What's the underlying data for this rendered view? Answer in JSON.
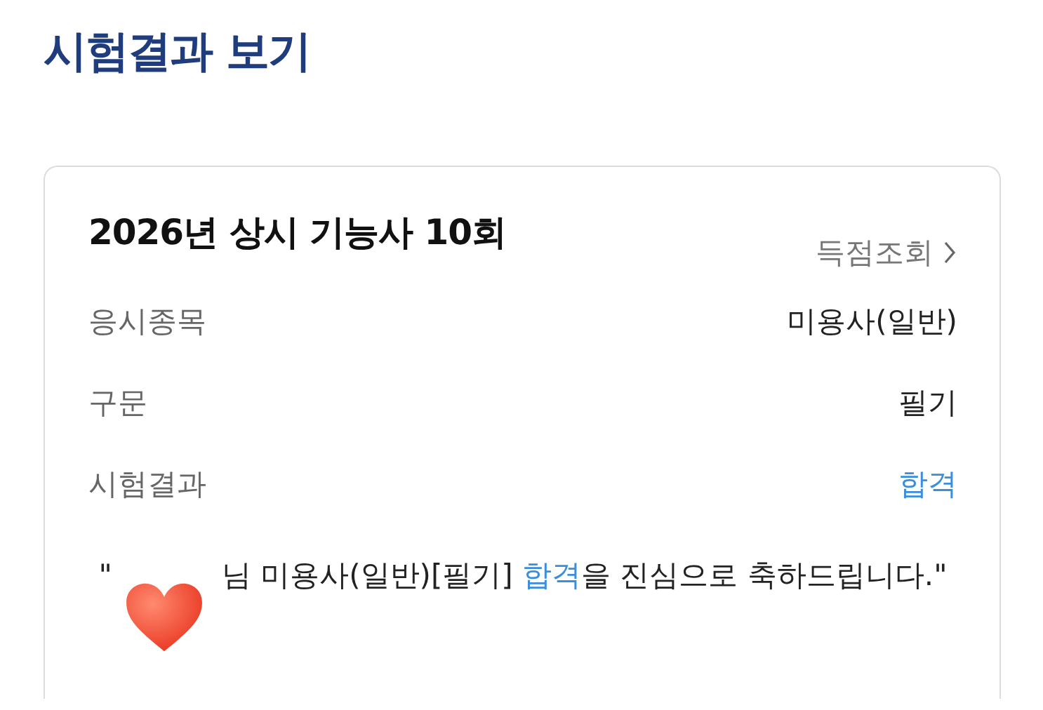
{
  "page_title": "시험결과 보기",
  "card": {
    "title": "2026년 상시 기능사 10회",
    "score_link": "득점조회",
    "rows": [
      {
        "label": "응시종목",
        "value": "미용사(일반)",
        "kind": "plain"
      },
      {
        "label": "구문",
        "value": "필기",
        "kind": "plain"
      },
      {
        "label": "시험결과",
        "value": "합격",
        "kind": "result"
      }
    ],
    "message": {
      "parts": [
        {
          "text": "\"",
          "kind": "plain"
        },
        {
          "kind": "covered"
        },
        {
          "text": "님 미용사(일반)[필기] ",
          "kind": "plain"
        },
        {
          "text": "합격",
          "kind": "result"
        },
        {
          "text": "을 진심으로 축하드립니다.\"",
          "kind": "plain"
        }
      ]
    }
  }
}
